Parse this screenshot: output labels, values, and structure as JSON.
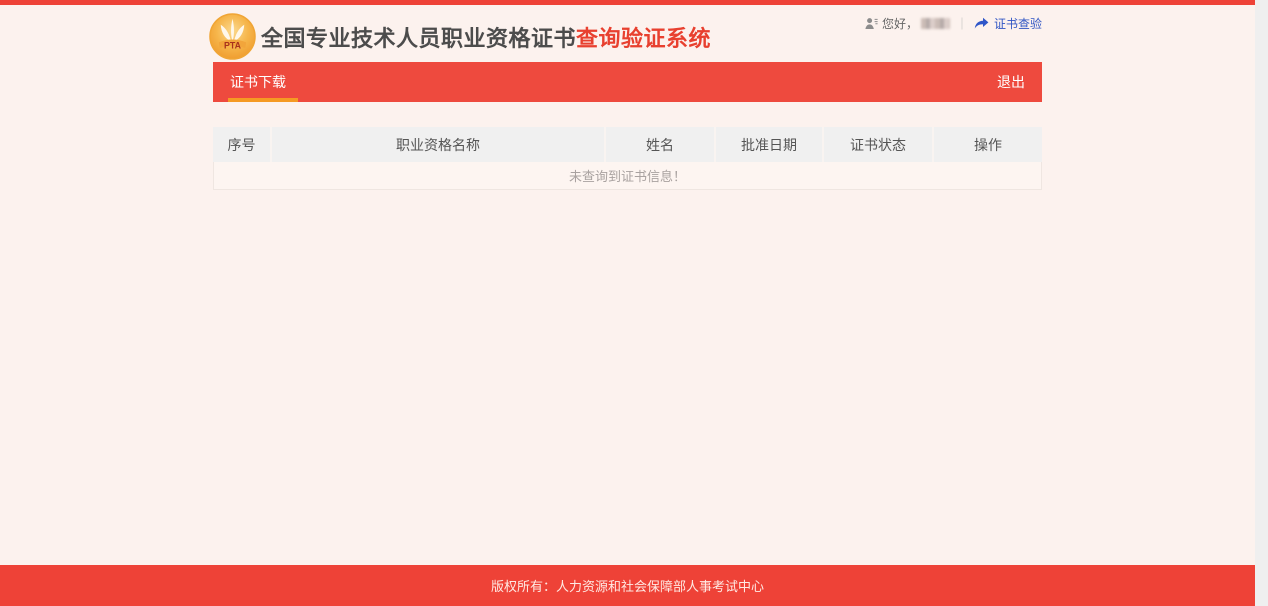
{
  "brand": {
    "logo_text": "PTA",
    "title_main": "全国专业技术人员职业资格证书",
    "title_accent": "查询验证系统"
  },
  "user_bar": {
    "greeting": "您好，",
    "divider": "｜",
    "verify_link": "证书查验"
  },
  "nav": {
    "active_tab": "证书下载",
    "logout": "退出"
  },
  "table": {
    "columns": [
      {
        "label": "序号"
      },
      {
        "label": "职业资格名称"
      },
      {
        "label": "姓名"
      },
      {
        "label": "批准日期"
      },
      {
        "label": "证书状态"
      },
      {
        "label": "操作"
      }
    ],
    "empty_message": "未查询到证书信息！"
  },
  "footer": {
    "copyright": "版权所有：人力资源和社会保障部人事考试中心"
  },
  "colors": {
    "primary_red": "#ee4237",
    "nav_red": "#ee4a3e",
    "accent_orange": "#f59a23",
    "link_blue": "#3156c4",
    "title_accent_red": "#e8402f",
    "page_bg": "#fcf2ee",
    "table_header_bg": "#f0f0f0",
    "scroll_track_gray": "#efefef"
  }
}
